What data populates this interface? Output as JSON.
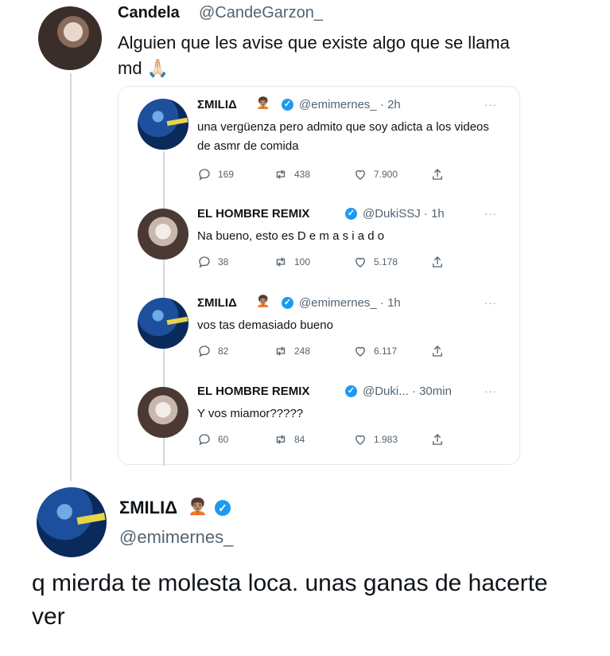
{
  "top_tweet": {
    "name": "Candela",
    "handle": "@CandeGarzon_",
    "text": "Alguien que les avise que existe algo que se llama md 🙏🏻"
  },
  "quoted_thread": [
    {
      "name": "ΣMILIΔ",
      "emoji": "🧑🏽‍🦱",
      "handle": "@emimernes_ · 2h",
      "text": "una vergüenza pero admito que soy adicta a los videos de asmr de comida",
      "replies": "169",
      "retweets": "438",
      "likes": "7.900"
    },
    {
      "name": "EL HOMBRE REMIX",
      "handle": "@DukiSSJ · 1h",
      "text": "Na bueno, esto es D e m a s i a d o",
      "replies": "38",
      "retweets": "100",
      "likes": "5.178"
    },
    {
      "name": "ΣMILIΔ",
      "emoji": "🧑🏽‍🦱",
      "handle": "@emimernes_ · 1h",
      "text": "vos tas demasiado bueno",
      "replies": "82",
      "retweets": "248",
      "likes": "6.117"
    },
    {
      "name": "EL HOMBRE REMIX",
      "handle": "@Duki... · 30min",
      "text": "Y vos miamor?????",
      "replies": "60",
      "retweets": "84",
      "likes": "1.983"
    }
  ],
  "more_label": "···",
  "bottom_tweet": {
    "name": "ΣMILIΔ",
    "emoji": "🧑🏽‍🦱",
    "handle": "@emimernes_",
    "text": "q mierda te molesta loca. unas ganas de hacerte ver"
  },
  "colors": {
    "accent": "#1d9bf0",
    "secondary_text": "#536471",
    "border": "#e4e9ec"
  },
  "icons": [
    "reply-icon",
    "retweet-icon",
    "like-icon",
    "share-icon",
    "verified-badge-icon",
    "more-icon"
  ]
}
